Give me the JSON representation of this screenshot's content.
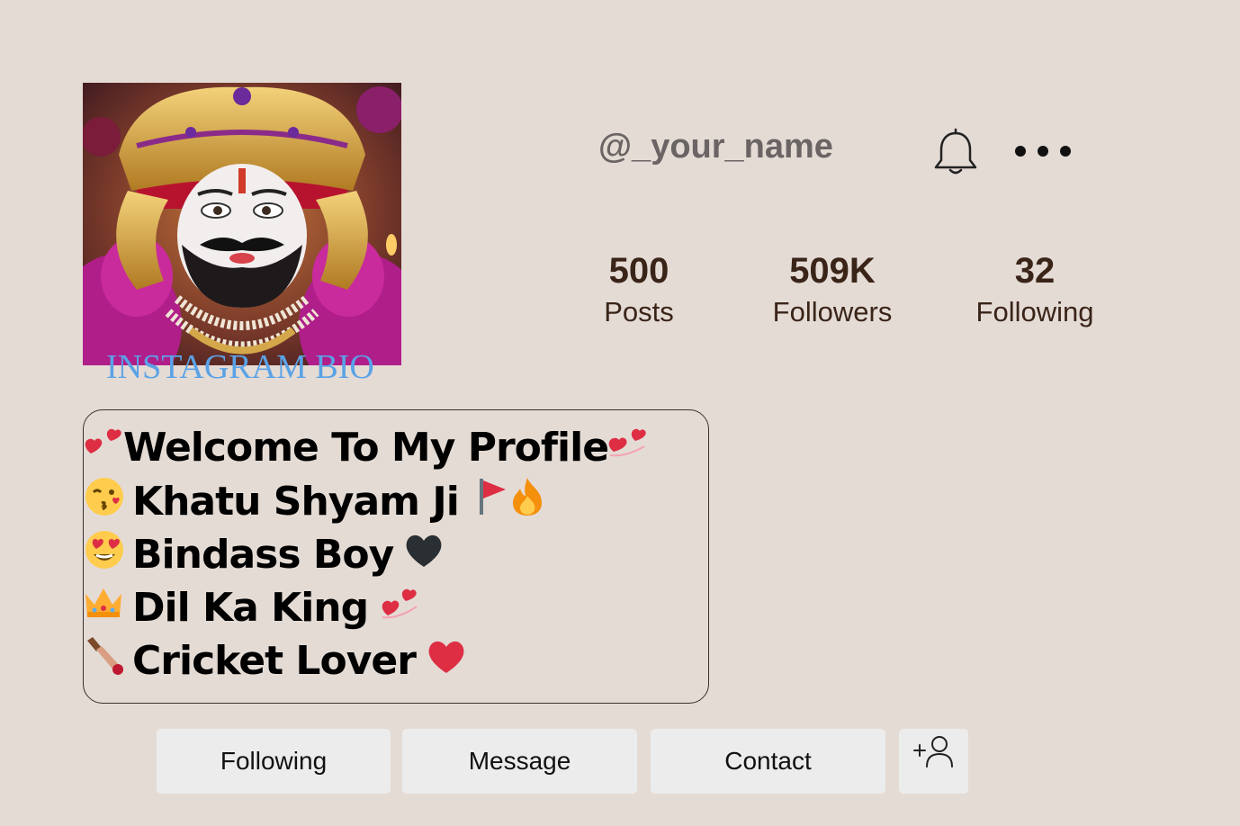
{
  "profile": {
    "username": "@_your_name",
    "avatar_watermark": "INSTAGRAM BIO",
    "icons": {
      "bell": "bell-icon",
      "more": "more-horizontal-icon",
      "add_user": "add-user-icon"
    }
  },
  "stats": [
    {
      "value": "500",
      "label": "Posts"
    },
    {
      "value": "509K",
      "label": "Followers"
    },
    {
      "value": "32",
      "label": "Following"
    }
  ],
  "bio": {
    "lines": [
      {
        "text": "Welcome To My Profile",
        "lead_icon": "two-hearts-icon",
        "trail_icons": [
          "two-hearts-icon"
        ]
      },
      {
        "text": "Khatu Shyam Ji",
        "lead_icon": "kissing-face-icon",
        "trail_icons": [
          "flag-icon",
          "fire-icon"
        ]
      },
      {
        "text": "Bindass Boy",
        "lead_icon": "heart-eyes-face-icon",
        "trail_icons": [
          "black-heart-icon"
        ]
      },
      {
        "text": "Dil Ka King",
        "lead_icon": "crown-icon",
        "trail_icons": [
          "two-hearts-icon"
        ]
      },
      {
        "text": "Cricket Lover",
        "lead_icon": "cricket-bat-icon",
        "trail_icons": [
          "red-heart-icon"
        ]
      }
    ]
  },
  "actions": {
    "following_label": "Following",
    "message_label": "Message",
    "contact_label": "Contact"
  },
  "colors": {
    "background": "#e4dbd5",
    "button_bg": "#ececec",
    "stat_text": "#3a2418",
    "username_text": "#6a6464",
    "watermark": "#5aa2e6",
    "heart_red": "#dd2e44"
  }
}
